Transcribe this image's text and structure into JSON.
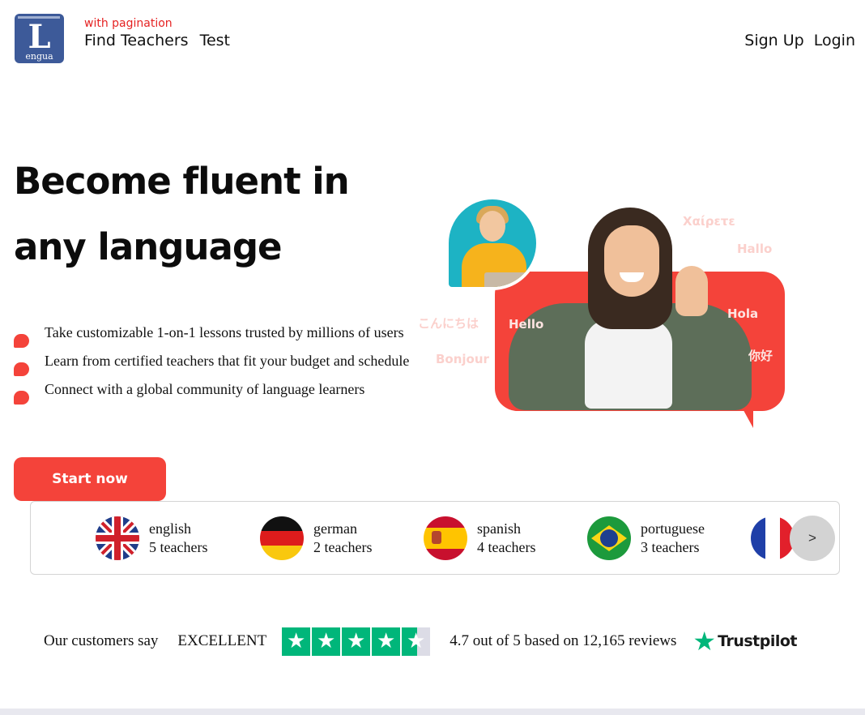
{
  "header": {
    "logo_letter": "L",
    "logo_sub": "engua",
    "subtitle": "with pagination",
    "nav": [
      "Find Teachers",
      "Test"
    ],
    "auth": {
      "signup": "Sign Up",
      "login": "Login"
    }
  },
  "hero": {
    "title": "Become fluent in any language",
    "features": [
      "Take customizable 1-on-1 lessons trusted by millions of users",
      "Learn from certified teachers that fit your budget and schedule",
      "Connect with a global community of language learners"
    ],
    "cta": "Start now",
    "illustration_words": [
      "Χαίρετε",
      "Hallo",
      "Hola",
      "こんにちは",
      "Hello",
      "Bonjour",
      "你好"
    ]
  },
  "languages": {
    "items": [
      {
        "name": "english",
        "teachers": "5 teachers",
        "flag": "uk-flag-icon"
      },
      {
        "name": "german",
        "teachers": "2 teachers",
        "flag": "germany-flag-icon"
      },
      {
        "name": "spanish",
        "teachers": "4 teachers",
        "flag": "spain-flag-icon"
      },
      {
        "name": "portuguese",
        "teachers": "3 teachers",
        "flag": "brazil-flag-icon"
      },
      {
        "name": "",
        "teachers": "",
        "flag": "france-flag-icon"
      }
    ],
    "next_label": ">"
  },
  "trustpilot": {
    "lead": "Our customers say",
    "rating_word": "EXCELLENT",
    "stars": 4.5,
    "score_text": "4.7 out of 5 based on 12,165 reviews",
    "brand": "Trustpilot"
  },
  "colors": {
    "accent": "#f4433a",
    "logo_bg": "#3d5a99",
    "trust_green": "#00b67a",
    "subtitle_red": "#e52222"
  }
}
